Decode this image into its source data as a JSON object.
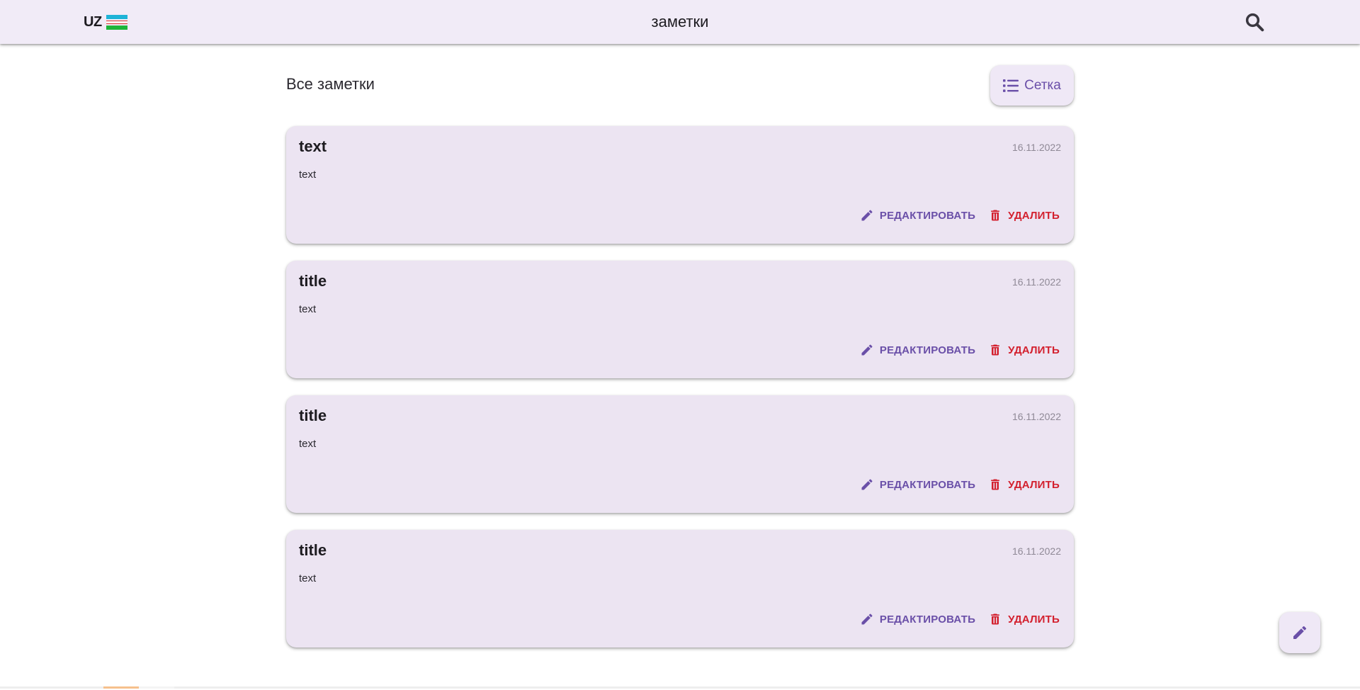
{
  "appbar": {
    "lang_code": "UZ",
    "title": "заметки",
    "search_icon": "search-icon"
  },
  "main": {
    "section_title": "Все заметки",
    "view_toggle_label": "Сетка",
    "view_toggle_icon": "list-icon"
  },
  "notes": [
    {
      "title": "text",
      "date": "16.11.2022",
      "text": "text",
      "edit_label": "РЕДАКТИРОВАТЬ",
      "delete_label": "УДАЛИТЬ"
    },
    {
      "title": "title",
      "date": "16.11.2022",
      "text": "text",
      "edit_label": "РЕДАКТИРОВАТЬ",
      "delete_label": "УДАЛИТЬ"
    },
    {
      "title": "title",
      "date": "16.11.2022",
      "text": "text",
      "edit_label": "РЕДАКТИРОВАТЬ",
      "delete_label": "УДАЛИТЬ"
    },
    {
      "title": "title",
      "date": "16.11.2022",
      "text": "text",
      "edit_label": "РЕДАКТИРОВАТЬ",
      "delete_label": "УДАЛИТЬ"
    }
  ],
  "fab": {
    "icon": "pencil-icon"
  },
  "colors": {
    "appbar_bg": "#f1ebf7",
    "card_bg": "#ece4f2",
    "accent": "#6a4fa8",
    "danger": "#d3202e"
  }
}
